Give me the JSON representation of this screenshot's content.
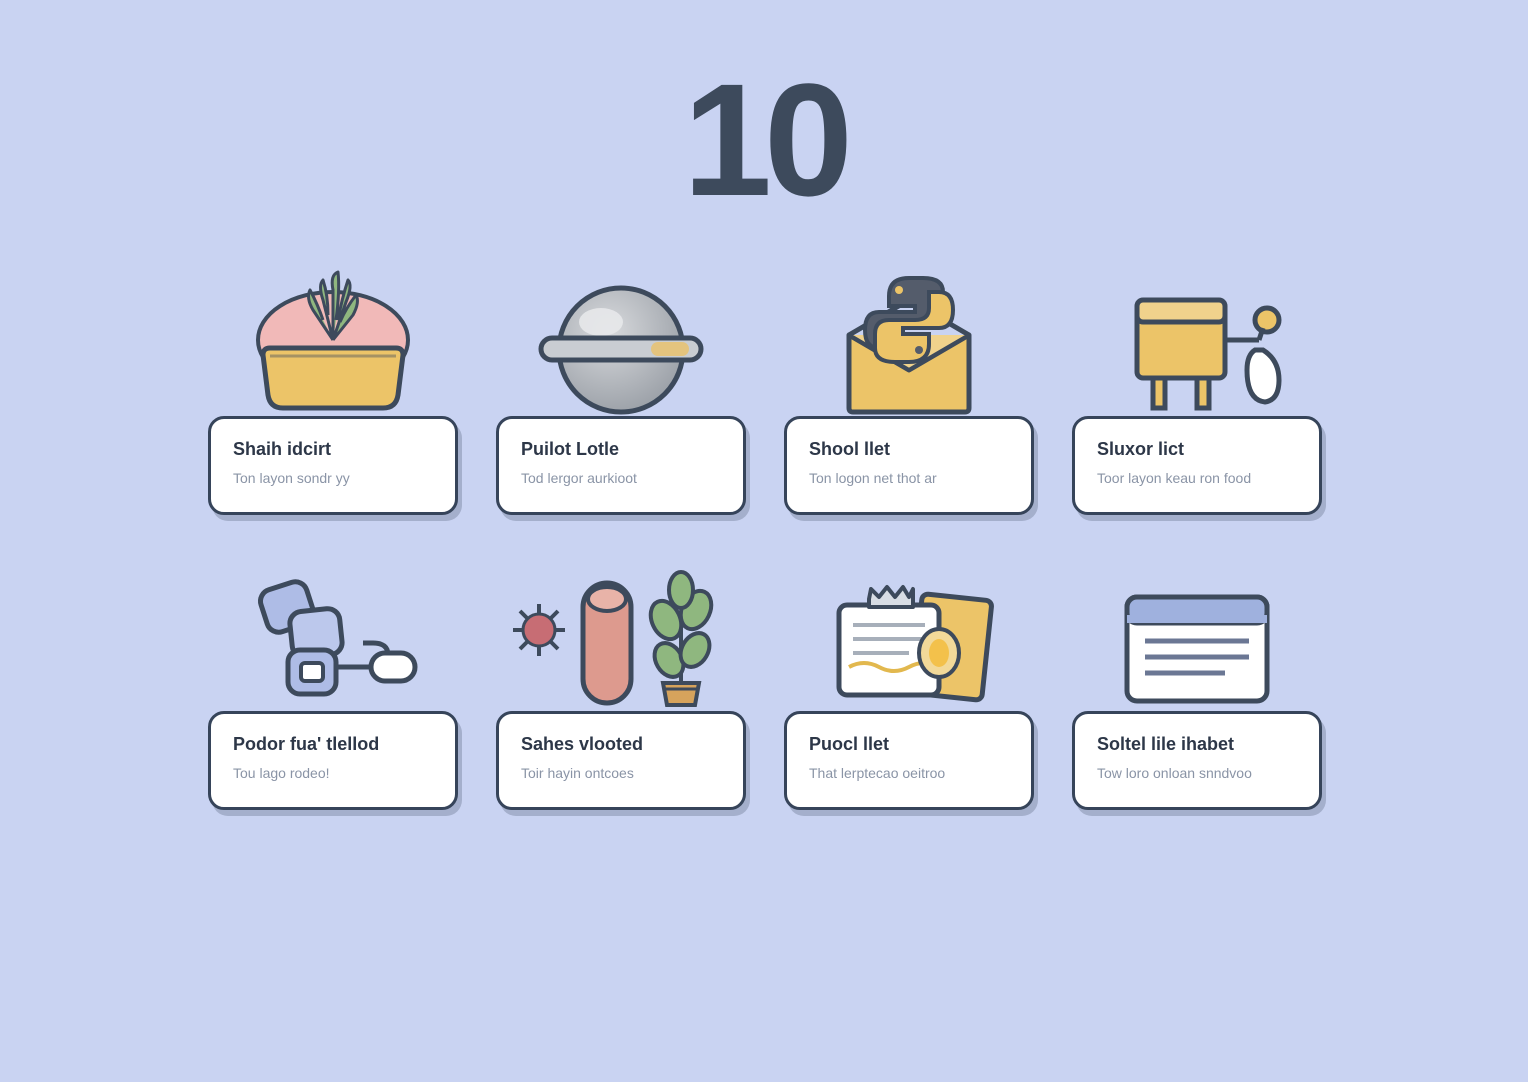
{
  "headline": "10",
  "cards": [
    {
      "title": "Shaih idcirt",
      "sub": "Ton layon sondr yy"
    },
    {
      "title": "Puilot Lotle",
      "sub": "Tod lergor aurkioot"
    },
    {
      "title": "Shool llet",
      "sub": "Ton logon net thot ar"
    },
    {
      "title": "Sluxor lict",
      "sub": "Toor layon keau ron food"
    },
    {
      "title": "Podor fua' tlellod",
      "sub": "Tou lago rodeo!"
    },
    {
      "title": "Sahes vlooted",
      "sub": "Toir hayin ontcoes"
    },
    {
      "title": "Puocl llet",
      "sub": "That lerptecao oeitroo"
    },
    {
      "title": "Soltel lile ihabet",
      "sub": "Tow loro onloan snndvoo"
    }
  ]
}
